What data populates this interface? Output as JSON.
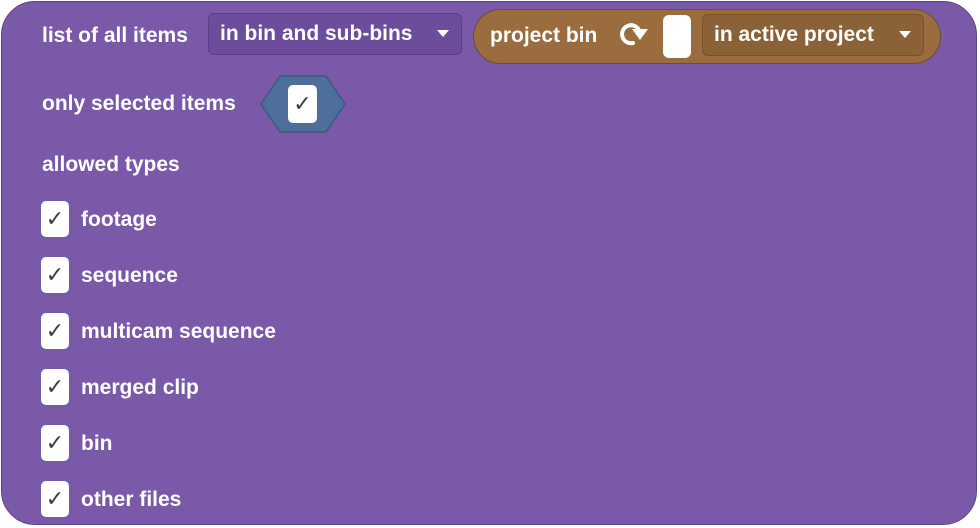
{
  "block": {
    "list_label": "list of all items",
    "scope_dropdown": "in bin and sub-bins",
    "reporter": {
      "label": "project bin",
      "icon": "rotate-arrow-icon",
      "project_dropdown": "in active project"
    },
    "only_selected_label": "only selected items",
    "only_selected_checked": true,
    "allowed_types_label": "allowed types",
    "check_glyph": "✓",
    "types": [
      {
        "label": "footage",
        "checked": true
      },
      {
        "label": "sequence",
        "checked": true
      },
      {
        "label": "multicam sequence",
        "checked": true
      },
      {
        "label": "merged clip",
        "checked": true
      },
      {
        "label": "bin",
        "checked": true
      },
      {
        "label": "other files",
        "checked": true
      }
    ]
  },
  "colors": {
    "block_bg": "#7b59a9",
    "reporter_bg": "#9a6c3e",
    "hexagon_bg": "#4d6f9a"
  }
}
